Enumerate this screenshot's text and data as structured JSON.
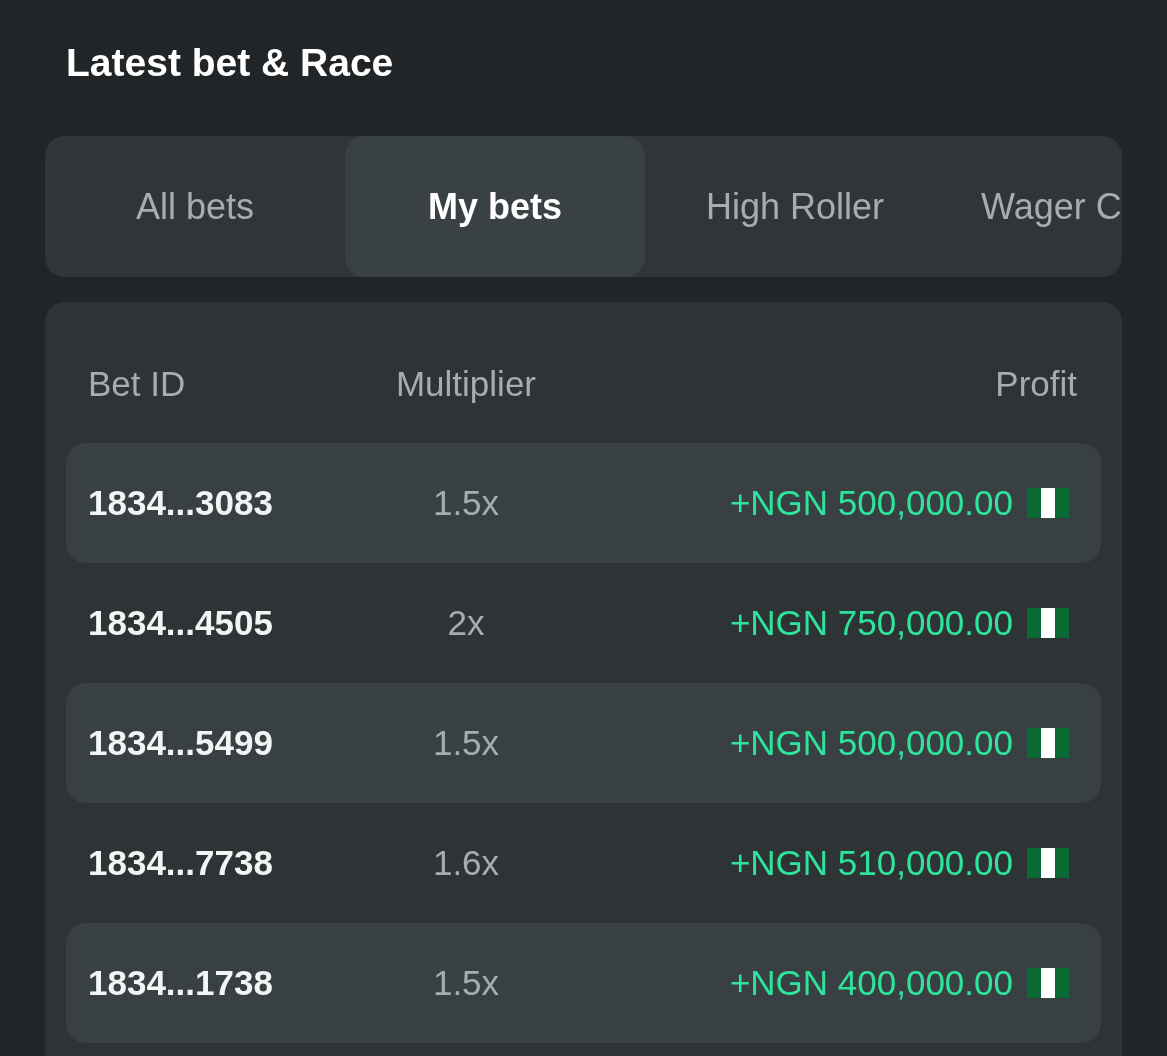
{
  "title": "Latest bet & Race",
  "tabs": [
    {
      "label": "All bets",
      "selected": false
    },
    {
      "label": "My bets",
      "selected": true
    },
    {
      "label": "High Roller",
      "selected": false
    },
    {
      "label": "Wager C",
      "selected": false
    }
  ],
  "table": {
    "columns": [
      "Bet ID",
      "Multiplier",
      "Profit"
    ],
    "rows": [
      {
        "bet_id": "1834...3083",
        "multiplier": "1.5x",
        "profit": "+NGN 500,000.00"
      },
      {
        "bet_id": "1834...4505",
        "multiplier": "2x",
        "profit": "+NGN 750,000.00"
      },
      {
        "bet_id": "1834...5499",
        "multiplier": "1.5x",
        "profit": "+NGN 500,000.00"
      },
      {
        "bet_id": "1834...7738",
        "multiplier": "1.6x",
        "profit": "+NGN 510,000.00"
      },
      {
        "bet_id": "1834...1738",
        "multiplier": "1.5x",
        "profit": "+NGN 400,000.00"
      }
    ]
  }
}
